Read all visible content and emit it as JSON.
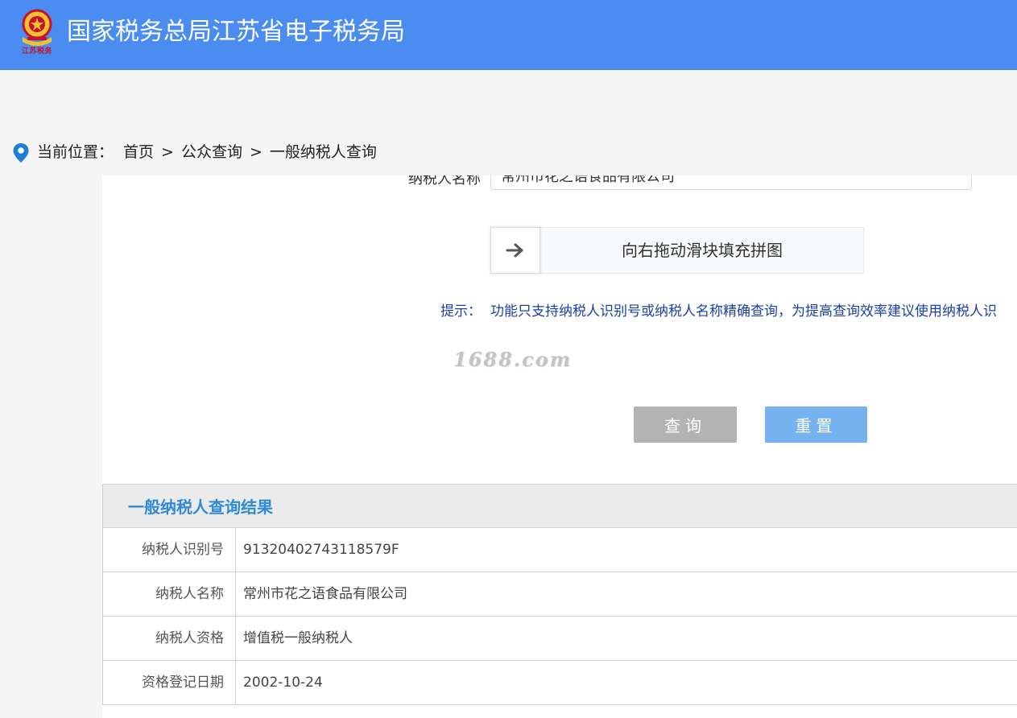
{
  "header": {
    "logo_caption": "江苏税务",
    "title": "国家税务总局江苏省电子税务局"
  },
  "breadcrumb": {
    "label": "当前位置：",
    "items": [
      "首页",
      "公众查询",
      "一般纳税人查询"
    ],
    "separator": ">"
  },
  "form": {
    "name_label": "纳税人名称",
    "name_value": "常州市花之语食品有限公司",
    "slider_text": "向右拖动滑块填充拼图",
    "tip_label": "提示：",
    "tip_text": "功能只支持纳税人识别号或纳税人名称精确查询，为提高查询效率建议使用纳税人识",
    "query_button": "查询",
    "reset_button": "重置"
  },
  "watermark": "1688.com",
  "results": {
    "title": "一般纳税人查询结果",
    "rows": [
      {
        "label": "纳税人识别号",
        "value": "91320402743118579F"
      },
      {
        "label": "纳税人名称",
        "value": "常州市花之语食品有限公司"
      },
      {
        "label": "纳税人资格",
        "value": "增值税一般纳税人"
      },
      {
        "label": "资格登记日期",
        "value": "2002-10-24"
      }
    ]
  },
  "colors": {
    "header_bg": "#4a8cf0",
    "query_button": "#b3b3b3",
    "reset_button": "#76b1f0",
    "tip_text": "#1a3fa8",
    "results_title": "#2f8ad8",
    "pin_icon": "#1e7fd6"
  },
  "icons": {
    "logo": "tax-emblem-icon",
    "location": "map-pin-icon",
    "slider_handle": "arrow-right-icon"
  }
}
